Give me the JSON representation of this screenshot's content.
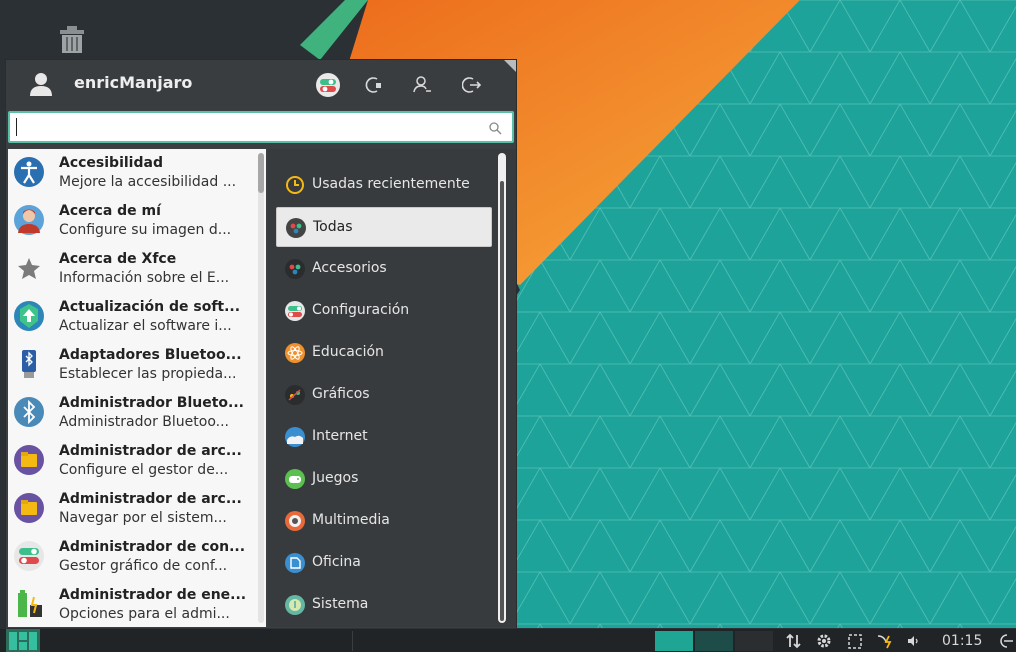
{
  "user": {
    "name": "enricManjaro"
  },
  "search": {
    "value": "",
    "placeholder": ""
  },
  "apps": [
    {
      "name": "Accesibilidad",
      "desc": "Mejore la accesibilidad ...",
      "icon": "accessibility-icon"
    },
    {
      "name": "Acerca de mí",
      "desc": "Configure su imagen d...",
      "icon": "user-profile-icon"
    },
    {
      "name": "Acerca de Xfce",
      "desc": "Información sobre el E...",
      "icon": "star-icon"
    },
    {
      "name": "Actualización de soft...",
      "desc": "Actualizar el software i...",
      "icon": "software-update-icon"
    },
    {
      "name": "Adaptadores Bluetoo...",
      "desc": "Establecer las propieda...",
      "icon": "bluetooth-adapter-icon"
    },
    {
      "name": "Administrador Blueto...",
      "desc": "Administrador Bluetoo...",
      "icon": "bluetooth-icon"
    },
    {
      "name": "Administrador de arc...",
      "desc": "Configure el gestor de...",
      "icon": "file-manager-icon"
    },
    {
      "name": "Administrador de arc...",
      "desc": "Navegar por el sistem...",
      "icon": "folder-icon"
    },
    {
      "name": "Administrador de con...",
      "desc": "Gestor gráfico de conf...",
      "icon": "settings-toggle-icon"
    },
    {
      "name": "Administrador de ene...",
      "desc": "Opciones para el admi...",
      "icon": "battery-icon"
    }
  ],
  "categories": [
    {
      "label": "Usadas recientemente",
      "icon": "clock-icon",
      "active": false
    },
    {
      "label": "Todas",
      "icon": "all-apps-icon",
      "active": true
    },
    {
      "label": "Accesorios",
      "icon": "accessories-icon",
      "active": false
    },
    {
      "label": "Configuración",
      "icon": "settings-icon",
      "active": false
    },
    {
      "label": "Educación",
      "icon": "education-icon",
      "active": false
    },
    {
      "label": "Gráficos",
      "icon": "graphics-icon",
      "active": false
    },
    {
      "label": "Internet",
      "icon": "internet-icon",
      "active": false
    },
    {
      "label": "Juegos",
      "icon": "games-icon",
      "active": false
    },
    {
      "label": "Multimedia",
      "icon": "multimedia-icon",
      "active": false
    },
    {
      "label": "Oficina",
      "icon": "office-icon",
      "active": false
    },
    {
      "label": "Sistema",
      "icon": "system-icon",
      "active": false
    }
  ],
  "header_buttons": [
    "settings-manager-icon",
    "lock-screen-icon",
    "switch-user-icon",
    "logout-icon"
  ],
  "panel": {
    "clock": "01:15"
  },
  "colors": {
    "accent": "#35bf9e",
    "desktop_teal": "#1ea39a",
    "orange": "#f28c28"
  }
}
